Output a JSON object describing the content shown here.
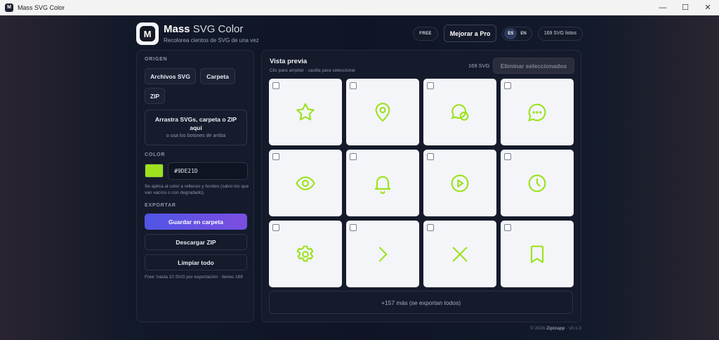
{
  "window": {
    "title": "Mass SVG Color",
    "minimize": "—",
    "maximize": "☐",
    "close": "✕"
  },
  "header": {
    "logo_letter": "M",
    "brand_bold": "Mass",
    "brand_light": " SVG Color",
    "tagline": "Recolorea cientos de SVG de una vez",
    "plan_badge": "FREE",
    "upgrade_label": "Mejorar a Pro",
    "languages": [
      "ES",
      "EN"
    ],
    "active_language": "ES",
    "status": "169 SVG listos"
  },
  "sidebar": {
    "origin_label": "ORIGEN",
    "origin_buttons": [
      "Archivos SVG",
      "Carpeta",
      "ZIP"
    ],
    "dropzone_title": "Arrastra SVGs, carpeta o ZIP aquí",
    "dropzone_sub": "o usa los botones de arriba",
    "color_label": "COLOR",
    "color_value": "#9DE21D",
    "color_hex": "#9DE21D",
    "color_help": "Se aplica al color a rellenos y bordes (salvo los que van vacíos o con degradado).",
    "export_label": "EXPORTAR",
    "save_folder": "Guardar en carpeta",
    "download_zip": "Descargar ZIP",
    "clear_all": "Limpiar todo",
    "export_note": "Free: hasta 10 SVG por exportación · tienes 169"
  },
  "preview": {
    "title": "Vista previa",
    "subtitle": "Clic para ampliar · casilla para seleccionar",
    "count": "169 SVG",
    "delete_selected": "Eliminar seleccionados",
    "icon_color": "#9DE21D",
    "icons": [
      "star-icon",
      "map-pin-icon",
      "chat-bubbles-icon",
      "message-dots-icon",
      "eye-icon",
      "bell-icon",
      "play-circle-icon",
      "clock-icon",
      "settings-gear-icon",
      "chevron-right-icon",
      "close-x-icon",
      "bookmark-icon"
    ],
    "more_label": "+157 más (se exportan todos)"
  },
  "footer": {
    "copyright": "© 2026 ",
    "brand": "Ziplzapp",
    "version": " · v0.1.0"
  }
}
